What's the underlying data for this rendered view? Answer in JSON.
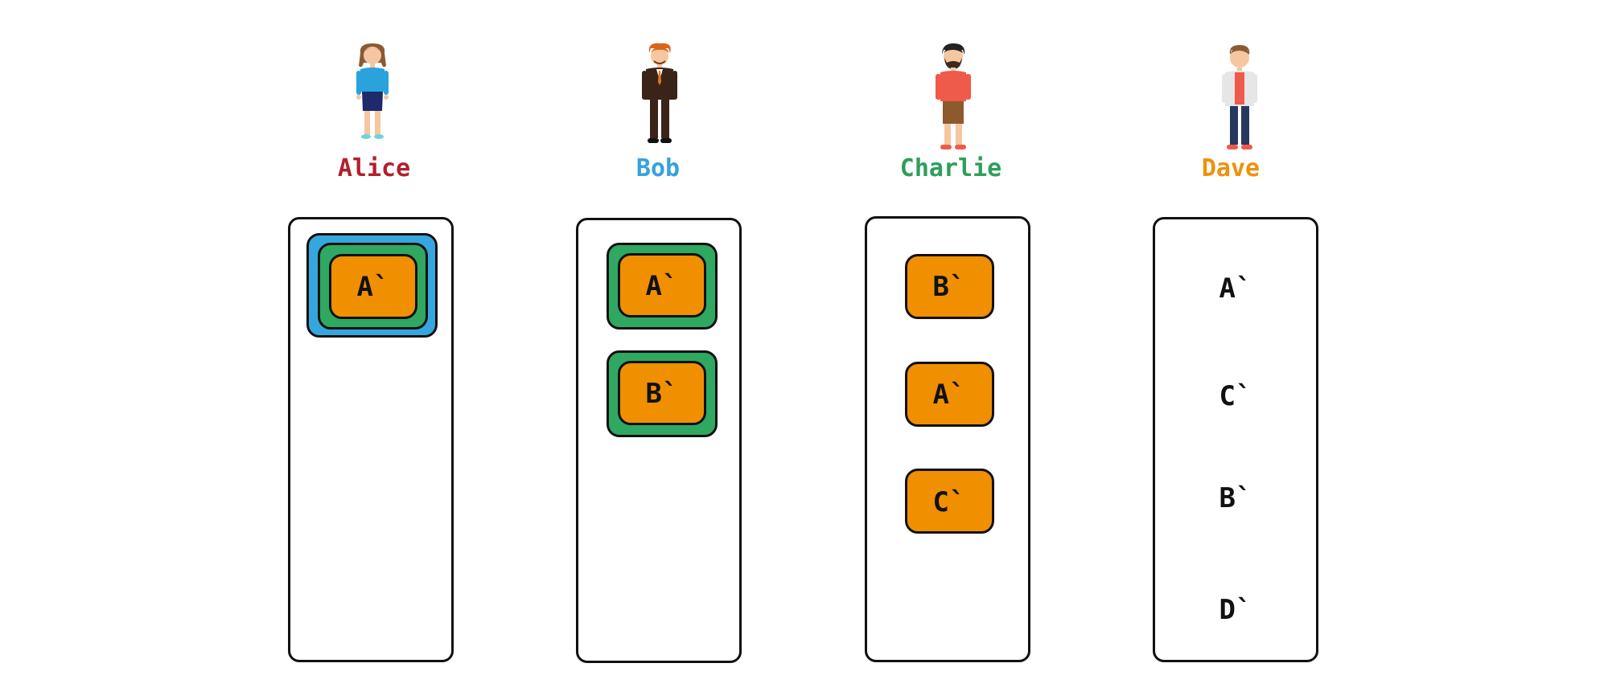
{
  "colors": {
    "alice": "#b21f2d",
    "bob": "#36a2db",
    "charlie": "#2e9e5b",
    "dave": "#f0900d",
    "blue_box": "#36a7de",
    "green_box": "#2fa862",
    "orange_box": "#f08f00"
  },
  "people": [
    {
      "name": "Alice"
    },
    {
      "name": "Bob"
    },
    {
      "name": "Charlie"
    },
    {
      "name": "Dave"
    }
  ],
  "alice_column": {
    "items": [
      "A`"
    ]
  },
  "bob_column": {
    "items": [
      "A`",
      "B`"
    ]
  },
  "charlie_column": {
    "items": [
      "B`",
      "A`",
      "C`"
    ]
  },
  "dave_column": {
    "items": [
      "A`",
      "C`",
      "B`",
      "D`"
    ]
  }
}
